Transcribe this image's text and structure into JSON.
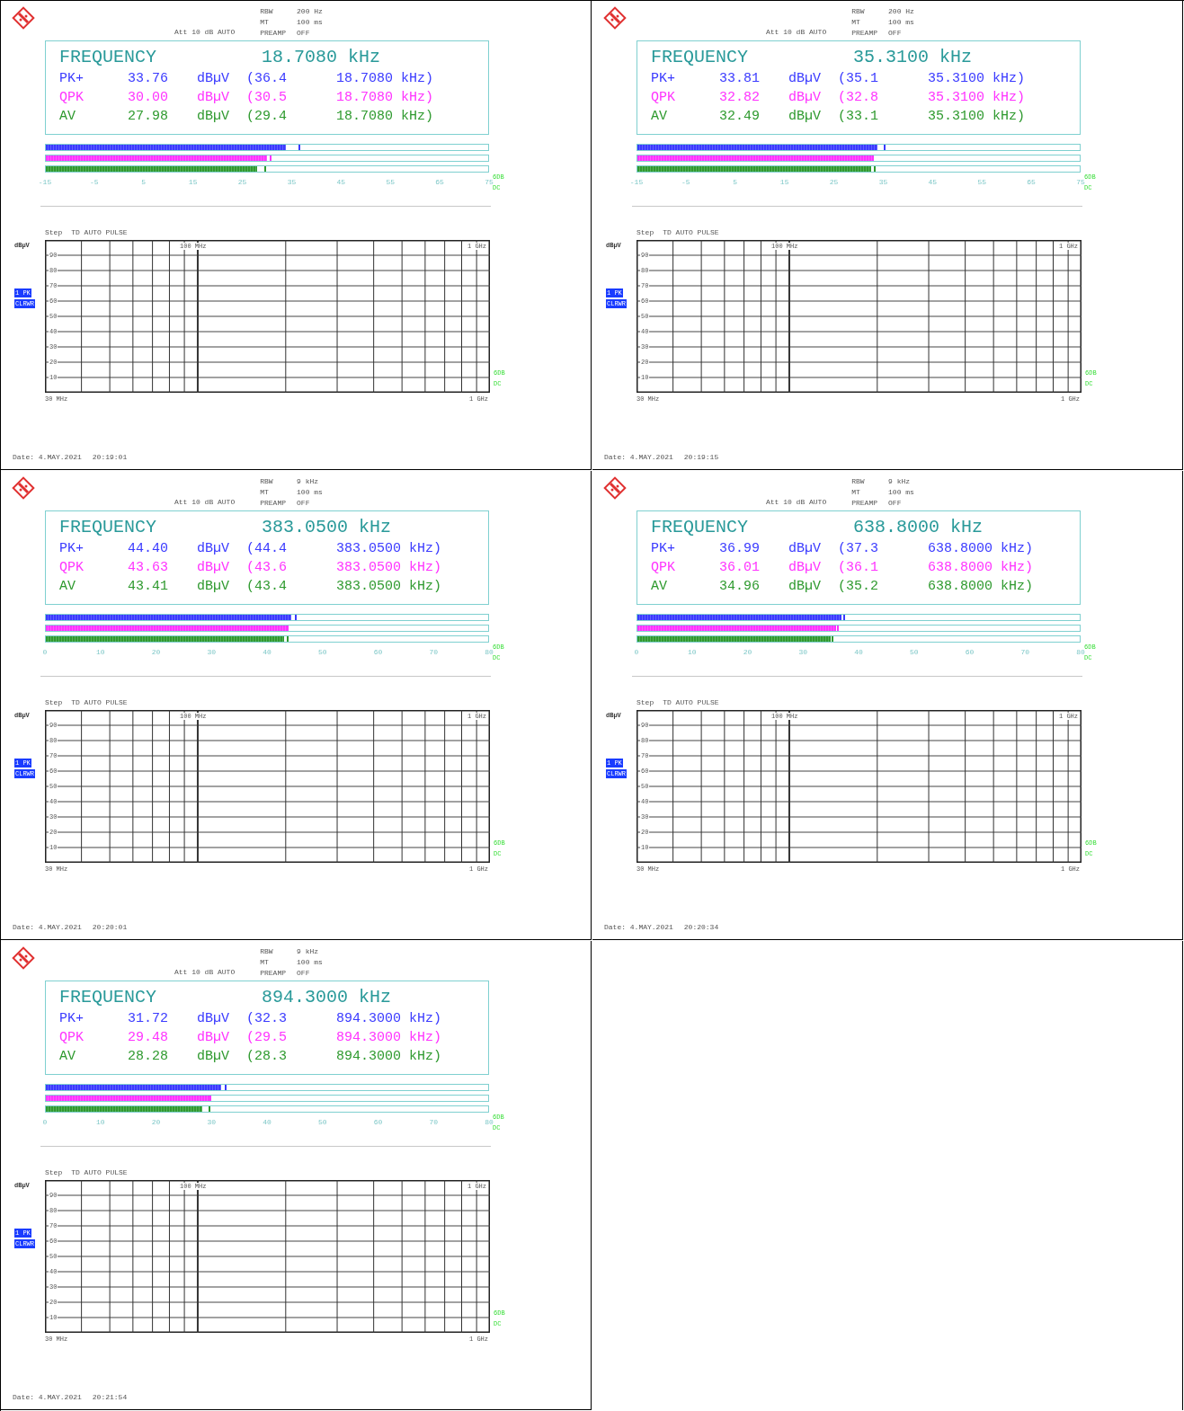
{
  "panels": [
    {
      "header": {
        "attenuation": "Att 10 dB AUTO",
        "settings": [
          {
            "label": "RBW",
            "value": "200 Hz"
          },
          {
            "label": "MT",
            "value": "100 ms"
          },
          {
            "label": "PREAMP",
            "value": "OFF"
          }
        ]
      },
      "readout": {
        "label": "FREQUENCY",
        "frequency": "18.7080 kHz",
        "detectors": [
          {
            "name": "PK+",
            "color": "#3a3aff",
            "value": "33.76",
            "unit": "dBµV",
            "peak": "(36.4",
            "at": "18.7080 kHz)",
            "level": 0.542,
            "hold": {
              "level": 0.571
            }
          },
          {
            "name": "QPK",
            "color": "#ff33ff",
            "value": "30.00",
            "unit": "dBµV",
            "peak": "(30.5",
            "at": "18.7080 kHz)",
            "level": 0.5,
            "hold": {
              "level": 0.506
            }
          },
          {
            "name": "AV",
            "color": "#2f9a2f",
            "value": "27.98",
            "unit": "dBµV",
            "peak": "(29.4",
            "at": "18.7080 kHz)",
            "level": 0.478,
            "hold": {
              "level": 0.493
            }
          }
        ]
      },
      "bar_scale": {
        "ticks": [
          "-15",
          "-5",
          "5",
          "15",
          "25",
          "35",
          "45",
          "55",
          "65",
          "75"
        ],
        "side_labels": [
          "6DB",
          "DC"
        ]
      },
      "graph": {
        "mode": "Step",
        "detector_mode": "TD AUTO PULSE",
        "y_unit": "dBµV",
        "trace_labels": [
          "1 PK",
          "CLRWR"
        ],
        "y_ticks": [
          "90",
          "80",
          "70",
          "60",
          "50",
          "40",
          "30",
          "20",
          "10"
        ],
        "marker_label": "100 MHz",
        "top_end": "1 GHz",
        "x_start": "30 MHz",
        "x_end": "1 GHz",
        "side_labels": [
          "6DB",
          "DC"
        ]
      },
      "date": "Date: 4.MAY.2021",
      "time": "20:19:01"
    },
    {
      "header": {
        "attenuation": "Att 10 dB AUTO",
        "settings": [
          {
            "label": "RBW",
            "value": "200 Hz"
          },
          {
            "label": "MT",
            "value": "100 ms"
          },
          {
            "label": "PREAMP",
            "value": "OFF"
          }
        ]
      },
      "readout": {
        "label": "FREQUENCY",
        "frequency": "35.3100 kHz",
        "detectors": [
          {
            "name": "PK+",
            "color": "#3a3aff",
            "value": "33.81",
            "unit": "dBµV",
            "peak": "(35.1",
            "at": "35.3100 kHz)",
            "level": 0.542,
            "hold": {
              "level": 0.557
            }
          },
          {
            "name": "QPK",
            "color": "#ff33ff",
            "value": "32.82",
            "unit": "dBµV",
            "peak": "(32.8",
            "at": "35.3100 kHz)",
            "level": 0.531,
            "hold": {
              "level": 0.531
            }
          },
          {
            "name": "AV",
            "color": "#2f9a2f",
            "value": "32.49",
            "unit": "dBµV",
            "peak": "(33.1",
            "at": "35.3100 kHz)",
            "level": 0.528,
            "hold": {
              "level": 0.535
            }
          }
        ]
      },
      "bar_scale": {
        "ticks": [
          "-15",
          "-5",
          "5",
          "15",
          "25",
          "35",
          "45",
          "55",
          "65",
          "75"
        ],
        "side_labels": [
          "6DB",
          "DC"
        ]
      },
      "graph": {
        "mode": "Step",
        "detector_mode": "TD AUTO PULSE",
        "y_unit": "dBµV",
        "trace_labels": [
          "1 PK",
          "CLRWR"
        ],
        "y_ticks": [
          "90",
          "80",
          "70",
          "60",
          "50",
          "40",
          "30",
          "20",
          "10"
        ],
        "marker_label": "100 MHz",
        "top_end": "1 GHz",
        "x_start": "30 MHz",
        "x_end": "1 GHz",
        "side_labels": [
          "6DB",
          "DC"
        ]
      },
      "date": "Date: 4.MAY.2021",
      "time": "20:19:15"
    },
    {
      "header": {
        "attenuation": "Att 10 dB AUTO",
        "settings": [
          {
            "label": "RBW",
            "value": "9 kHz"
          },
          {
            "label": "MT",
            "value": "100 ms"
          },
          {
            "label": "PREAMP",
            "value": "OFF"
          }
        ]
      },
      "readout": {
        "label": "FREQUENCY",
        "frequency": "383.0500 kHz",
        "detectors": [
          {
            "name": "PK+",
            "color": "#3a3aff",
            "value": "44.40",
            "unit": "dBµV",
            "peak": "(44.4",
            "at": "383.0500 kHz)",
            "level": 0.555,
            "hold": {
              "level": 0.562
            }
          },
          {
            "name": "QPK",
            "color": "#ff33ff",
            "value": "43.63",
            "unit": "dBµV",
            "peak": "(43.6",
            "at": "383.0500 kHz)",
            "level": 0.545,
            "hold": {
              "level": 0.545
            }
          },
          {
            "name": "AV",
            "color": "#2f9a2f",
            "value": "43.41",
            "unit": "dBµV",
            "peak": "(43.4",
            "at": "383.0500 kHz)",
            "level": 0.538,
            "hold": {
              "level": 0.545
            }
          }
        ]
      },
      "bar_scale": {
        "ticks": [
          "0",
          "10",
          "20",
          "30",
          "40",
          "50",
          "60",
          "70",
          "80"
        ],
        "side_labels": [
          "6DB",
          "DC"
        ]
      },
      "graph": {
        "mode": "Step",
        "detector_mode": "TD AUTO PULSE",
        "y_unit": "dBµV",
        "trace_labels": [
          "1 PK",
          "CLRWR"
        ],
        "y_ticks": [
          "90",
          "80",
          "70",
          "60",
          "50",
          "40",
          "30",
          "20",
          "10"
        ],
        "marker_label": "100 MHz",
        "top_end": "1 GHz",
        "x_start": "30 MHz",
        "x_end": "1 GHz",
        "side_labels": [
          "6DB",
          "DC"
        ]
      },
      "date": "Date: 4.MAY.2021",
      "time": "20:20:01"
    },
    {
      "header": {
        "attenuation": "Att 10 dB AUTO",
        "settings": [
          {
            "label": "RBW",
            "value": "9 kHz"
          },
          {
            "label": "MT",
            "value": "100 ms"
          },
          {
            "label": "PREAMP",
            "value": "OFF"
          }
        ]
      },
      "readout": {
        "label": "FREQUENCY",
        "frequency": "638.8000 kHz",
        "detectors": [
          {
            "name": "PK+",
            "color": "#3a3aff",
            "value": "36.99",
            "unit": "dBµV",
            "peak": "(37.3",
            "at": "638.8000 kHz)",
            "level": 0.462,
            "hold": {
              "level": 0.466
            }
          },
          {
            "name": "QPK",
            "color": "#ff33ff",
            "value": "36.01",
            "unit": "dBµV",
            "peak": "(36.1",
            "at": "638.8000 kHz)",
            "level": 0.45,
            "hold": {
              "level": 0.451
            }
          },
          {
            "name": "AV",
            "color": "#2f9a2f",
            "value": "34.96",
            "unit": "dBµV",
            "peak": "(35.2",
            "at": "638.8000 kHz)",
            "level": 0.437,
            "hold": {
              "level": 0.44
            }
          }
        ]
      },
      "bar_scale": {
        "ticks": [
          "0",
          "10",
          "20",
          "30",
          "40",
          "50",
          "60",
          "70",
          "80"
        ],
        "side_labels": [
          "6DB",
          "DC"
        ]
      },
      "graph": {
        "mode": "Step",
        "detector_mode": "TD AUTO PULSE",
        "y_unit": "dBµV",
        "trace_labels": [
          "1 PK",
          "CLRWR"
        ],
        "y_ticks": [
          "90",
          "80",
          "70",
          "60",
          "50",
          "40",
          "30",
          "20",
          "10"
        ],
        "marker_label": "100 MHz",
        "top_end": "1 GHz",
        "x_start": "30 MHz",
        "x_end": "1 GHz",
        "side_labels": [
          "6DB",
          "DC"
        ]
      },
      "date": "Date: 4.MAY.2021",
      "time": "20:20:34"
    },
    {
      "header": {
        "attenuation": "Att 10 dB AUTO",
        "settings": [
          {
            "label": "RBW",
            "value": "9 kHz"
          },
          {
            "label": "MT",
            "value": "100 ms"
          },
          {
            "label": "PREAMP",
            "value": "OFF"
          }
        ]
      },
      "readout": {
        "label": "FREQUENCY",
        "frequency": "894.3000 kHz",
        "detectors": [
          {
            "name": "PK+",
            "color": "#3a3aff",
            "value": "31.72",
            "unit": "dBµV",
            "peak": "(32.3",
            "at": "894.3000 kHz)",
            "level": 0.397,
            "hold": {
              "level": 0.404
            }
          },
          {
            "name": "QPK",
            "color": "#ff33ff",
            "value": "29.48",
            "unit": "dBµV",
            "peak": "(29.5",
            "at": "894.3000 kHz)",
            "level": 0.369,
            "hold": {
              "level": 0.369
            }
          },
          {
            "name": "AV",
            "color": "#2f9a2f",
            "value": "28.28",
            "unit": "dBµV",
            "peak": "(28.3",
            "at": "894.3000 kHz)",
            "level": 0.354,
            "hold": {
              "level": 0.368
            }
          }
        ]
      },
      "bar_scale": {
        "ticks": [
          "0",
          "10",
          "20",
          "30",
          "40",
          "50",
          "60",
          "70",
          "80"
        ],
        "side_labels": [
          "6DB",
          "DC"
        ]
      },
      "graph": {
        "mode": "Step",
        "detector_mode": "TD AUTO PULSE",
        "y_unit": "dBµV",
        "trace_labels": [
          "1 PK",
          "CLRWR"
        ],
        "y_ticks": [
          "90",
          "80",
          "70",
          "60",
          "50",
          "40",
          "30",
          "20",
          "10"
        ],
        "marker_label": "100 MHz",
        "top_end": "1 GHz",
        "x_start": "30 MHz",
        "x_end": "1 GHz",
        "side_labels": [
          "6DB",
          "DC"
        ]
      },
      "date": "Date: 4.MAY.2021",
      "time": "20:21:54"
    }
  ]
}
